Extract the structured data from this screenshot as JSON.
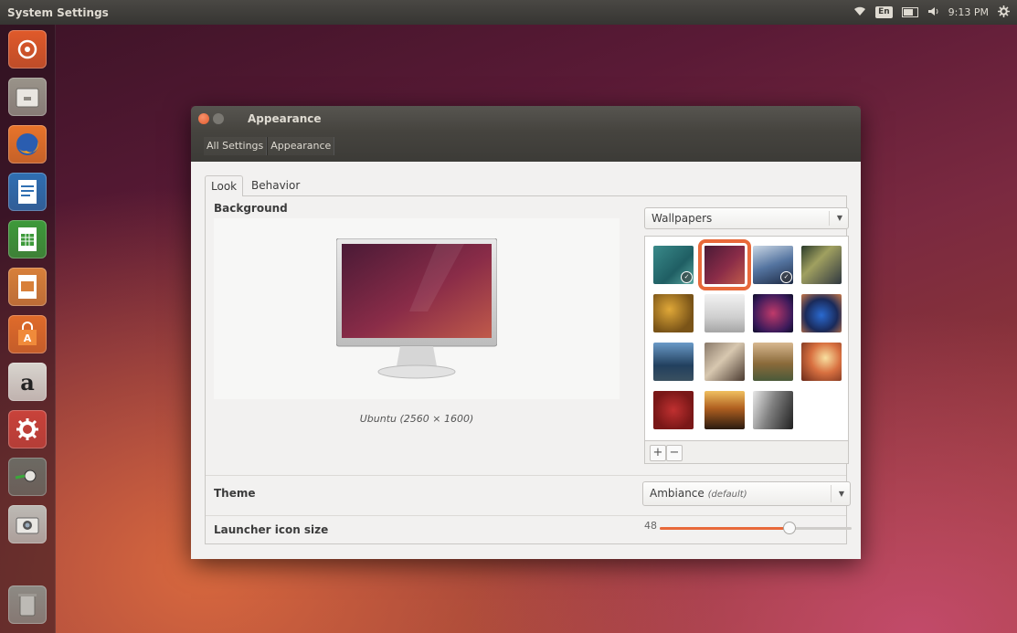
{
  "top_panel": {
    "title": "System Settings",
    "keyboard_layout": "En",
    "time": "9:13 PM"
  },
  "launcher": {
    "items": [
      {
        "name": "dash-home-icon",
        "color": "#e05a2a"
      },
      {
        "name": "files-icon",
        "color": "#9a948a"
      },
      {
        "name": "firefox-icon",
        "color": "#e8742a"
      },
      {
        "name": "libreoffice-writer-icon",
        "color": "#2f6fb2"
      },
      {
        "name": "libreoffice-calc-icon",
        "color": "#3d9a3a"
      },
      {
        "name": "libreoffice-impress-icon",
        "color": "#d8803a"
      },
      {
        "name": "software-center-icon",
        "color": "#e06b2a"
      },
      {
        "name": "amazon-icon",
        "color": "#d9d5cf"
      },
      {
        "name": "system-settings-icon",
        "color": "#c9423a"
      },
      {
        "name": "screenshot-tool-icon",
        "color": "#6c6a63"
      },
      {
        "name": "camera-icon",
        "color": "#bdbab5"
      },
      {
        "name": "trash-icon",
        "color": "#8d8a84"
      }
    ],
    "amazon_glyph": "a"
  },
  "window": {
    "title": "Appearance",
    "breadcrumbs": [
      "All Settings",
      "Appearance"
    ],
    "tabs": [
      "Look",
      "Behavior"
    ],
    "background_label": "Background",
    "wallpaper_caption": "Ubuntu (2560 × 1600)",
    "source_select": "Wallpapers",
    "add_button": "+",
    "remove_button": "−",
    "theme_label": "Theme",
    "theme_value": "Ambiance",
    "theme_default_note": "(default)",
    "launcher_size_label": "Launcher icon size",
    "launcher_size_value": "48",
    "launcher_size_fraction": 0.67
  },
  "accent_color": "#e8693a"
}
